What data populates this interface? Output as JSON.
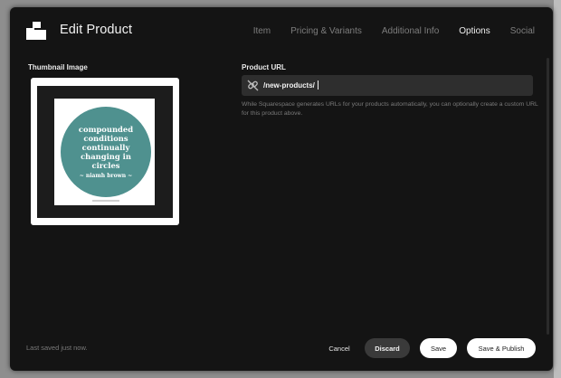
{
  "header": {
    "title": "Edit Product",
    "logo_icon": "squarespace-stack-icon",
    "tabs": [
      {
        "label": "Item",
        "active": false
      },
      {
        "label": "Pricing & Variants",
        "active": false
      },
      {
        "label": "Additional Info",
        "active": false
      },
      {
        "label": "Options",
        "active": true
      },
      {
        "label": "Social",
        "active": false
      }
    ]
  },
  "thumbnail": {
    "label": "Thumbnail Image",
    "image_text": [
      "compounded",
      "conditions",
      "continually",
      "changing in",
      "circles"
    ],
    "image_author": "~ niamh brown ~",
    "badge_color": "#4f918f"
  },
  "product_url": {
    "label": "Product URL",
    "value": "/new-products/",
    "icon": "link-icon",
    "help": "While Squarespace generates URLs for your products automatically, you can optionally create a custom URL for this product above."
  },
  "footer": {
    "status": "Last saved just now.",
    "cancel_label": "Cancel",
    "discard_label": "Discard",
    "save_label": "Save",
    "publish_label": "Save & Publish"
  },
  "colors": {
    "modal_bg": "#141414",
    "field_bg": "#2e2e2e",
    "accent_teal": "#4f918f"
  }
}
